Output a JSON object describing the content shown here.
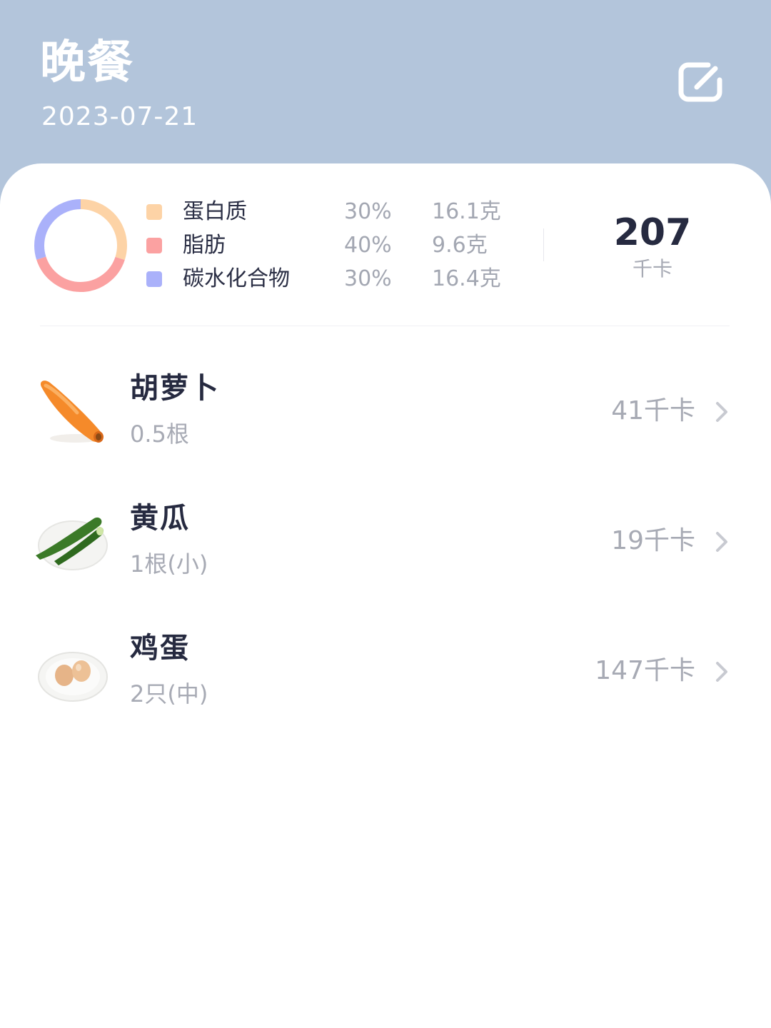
{
  "header": {
    "title": "晚餐",
    "date": "2023-07-21",
    "edit_icon": "edit-icon",
    "bg_color": "#b3c5db"
  },
  "nutrition": {
    "macros": [
      {
        "name": "蛋白质",
        "percent": "30%",
        "grams": "16.1克",
        "color": "#fdd3a6",
        "share": 0.3
      },
      {
        "name": "脂肪",
        "percent": "40%",
        "grams": "9.6克",
        "color": "#fba1a1",
        "share": 0.4
      },
      {
        "name": "碳水化合物",
        "percent": "30%",
        "grams": "16.4克",
        "color": "#aab1fa",
        "share": 0.3
      }
    ],
    "total_kcal": "207",
    "kcal_unit": "千卡"
  },
  "foods": [
    {
      "name": "胡萝卜",
      "amount": "0.5根",
      "kcal": "41千卡",
      "icon": "carrot"
    },
    {
      "name": "黄瓜",
      "amount": "1根(小)",
      "kcal": "19千卡",
      "icon": "cucumber"
    },
    {
      "name": "鸡蛋",
      "amount": "2只(中)",
      "kcal": "147千卡",
      "icon": "eggs"
    }
  ]
}
